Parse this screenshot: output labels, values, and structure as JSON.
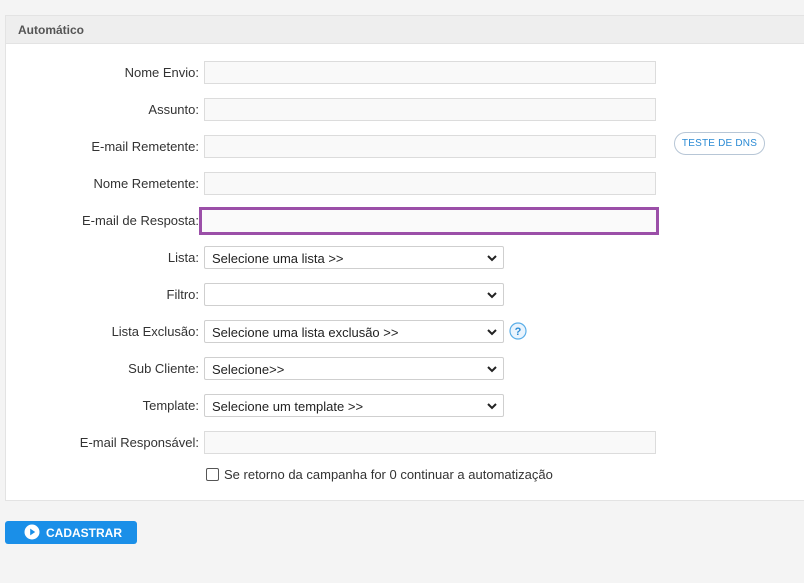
{
  "panel": {
    "title": "Automático"
  },
  "form": {
    "nome_envio": {
      "label": "Nome Envio:",
      "value": ""
    },
    "assunto": {
      "label": "Assunto:",
      "value": ""
    },
    "email_remetente": {
      "label": "E-mail Remetente:",
      "value": ""
    },
    "dns_button": "TESTE DE DNS",
    "nome_remetente": {
      "label": "Nome Remetente:",
      "value": ""
    },
    "email_resposta": {
      "label": "E-mail de Resposta:",
      "value": ""
    },
    "lista": {
      "label": "Lista:",
      "selected": "Selecione uma lista >>"
    },
    "filtro": {
      "label": "Filtro:",
      "selected": ""
    },
    "lista_exclusao": {
      "label": "Lista Exclusão:",
      "selected": "Selecione uma lista exclusão >>"
    },
    "sub_cliente": {
      "label": "Sub Cliente:",
      "selected": "Selecione>>"
    },
    "template": {
      "label": "Template:",
      "selected": "Selecione um template >>"
    },
    "email_responsavel": {
      "label": "E-mail Responsável:",
      "value": ""
    },
    "continuar": {
      "label": "Se retorno da campanha for 0 continuar a automatização",
      "checked": false
    }
  },
  "submit_label": "CADASTRAR",
  "icons": {
    "help": "help-icon",
    "play": "play-icon",
    "chevron": "chevron-down-icon"
  },
  "colors": {
    "accent": "#1a8fe8",
    "focus_border": "#9b4fa8",
    "dns_text": "#2a8ad4"
  }
}
